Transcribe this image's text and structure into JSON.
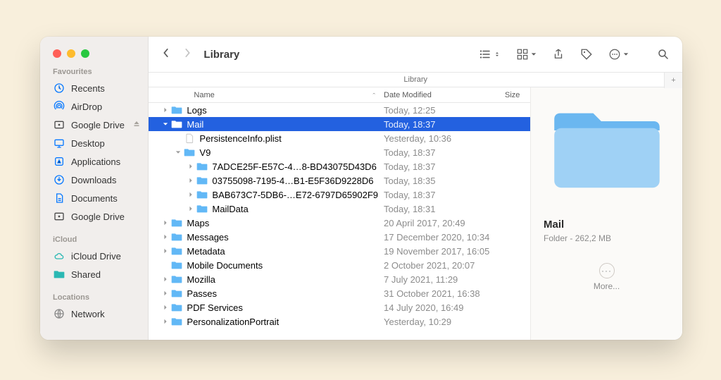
{
  "window_title": "Library",
  "pathbar_title": "Library",
  "sidebar": {
    "sections": [
      {
        "label": "Favourites",
        "items": [
          {
            "name": "Recents",
            "icon": "clock",
            "color": "#0a7aff"
          },
          {
            "name": "AirDrop",
            "icon": "airdrop",
            "color": "#0a7aff"
          },
          {
            "name": "Google Drive",
            "icon": "box",
            "color": "#4a4a4a",
            "eject": true
          },
          {
            "name": "Desktop",
            "icon": "desktop",
            "color": "#0a7aff"
          },
          {
            "name": "Applications",
            "icon": "app",
            "color": "#0a7aff"
          },
          {
            "name": "Downloads",
            "icon": "download",
            "color": "#0a7aff"
          },
          {
            "name": "Documents",
            "icon": "doc",
            "color": "#0a7aff"
          },
          {
            "name": "Google Drive",
            "icon": "box",
            "color": "#4a4a4a"
          }
        ]
      },
      {
        "label": "iCloud",
        "items": [
          {
            "name": "iCloud Drive",
            "icon": "cloud",
            "color": "#2bb8b3"
          },
          {
            "name": "Shared",
            "icon": "folder",
            "color": "#2bb8b3"
          }
        ]
      },
      {
        "label": "Locations",
        "items": [
          {
            "name": "Network",
            "icon": "globe",
            "color": "#8a8a8a"
          }
        ]
      }
    ]
  },
  "columns": {
    "name": "Name",
    "date": "Date Modified",
    "size": "Size"
  },
  "rows": [
    {
      "depth": 0,
      "arrow": "right",
      "icon": "folder",
      "name": "Logs",
      "date": "Today, 12:25"
    },
    {
      "depth": 0,
      "arrow": "down",
      "icon": "folder",
      "name": "Mail",
      "date": "Today, 18:37",
      "selected": true
    },
    {
      "depth": 1,
      "arrow": "",
      "icon": "file",
      "name": "PersistenceInfo.plist",
      "date": "Yesterday, 10:36"
    },
    {
      "depth": 1,
      "arrow": "down",
      "icon": "folder",
      "name": "V9",
      "date": "Today, 18:37"
    },
    {
      "depth": 2,
      "arrow": "right",
      "icon": "folder",
      "name": "7ADCE25F-E57C-4…8-BD43075D43D6",
      "date": "Today, 18:37"
    },
    {
      "depth": 2,
      "arrow": "right",
      "icon": "folder",
      "name": "03755098-7195-4…B1-E5F36D9228D6",
      "date": "Today, 18:35"
    },
    {
      "depth": 2,
      "arrow": "right",
      "icon": "folder",
      "name": "BAB673C7-5DB6-…E72-6797D65902F9",
      "date": "Today, 18:37"
    },
    {
      "depth": 2,
      "arrow": "right",
      "icon": "folder",
      "name": "MailData",
      "date": "Today, 18:31"
    },
    {
      "depth": 0,
      "arrow": "right",
      "icon": "folder",
      "name": "Maps",
      "date": "20 April 2017, 20:49"
    },
    {
      "depth": 0,
      "arrow": "right",
      "icon": "folder",
      "name": "Messages",
      "date": "17 December 2020, 10:34"
    },
    {
      "depth": 0,
      "arrow": "right",
      "icon": "folder",
      "name": "Metadata",
      "date": "19 November 2017, 16:05"
    },
    {
      "depth": 0,
      "arrow": "",
      "icon": "folder",
      "name": "Mobile Documents",
      "date": "2 October 2021, 20:07"
    },
    {
      "depth": 0,
      "arrow": "right",
      "icon": "folder",
      "name": "Mozilla",
      "date": "7 July 2021, 11:29"
    },
    {
      "depth": 0,
      "arrow": "right",
      "icon": "folder",
      "name": "Passes",
      "date": "31 October 2021, 16:38"
    },
    {
      "depth": 0,
      "arrow": "right",
      "icon": "folder",
      "name": "PDF Services",
      "date": "14 July 2020, 16:49"
    },
    {
      "depth": 0,
      "arrow": "right",
      "icon": "folder",
      "name": "PersonalizationPortrait",
      "date": "Yesterday, 10:29"
    }
  ],
  "preview": {
    "name": "Mail",
    "kind": "Folder",
    "size": "262,2 MB",
    "more_label": "More..."
  }
}
